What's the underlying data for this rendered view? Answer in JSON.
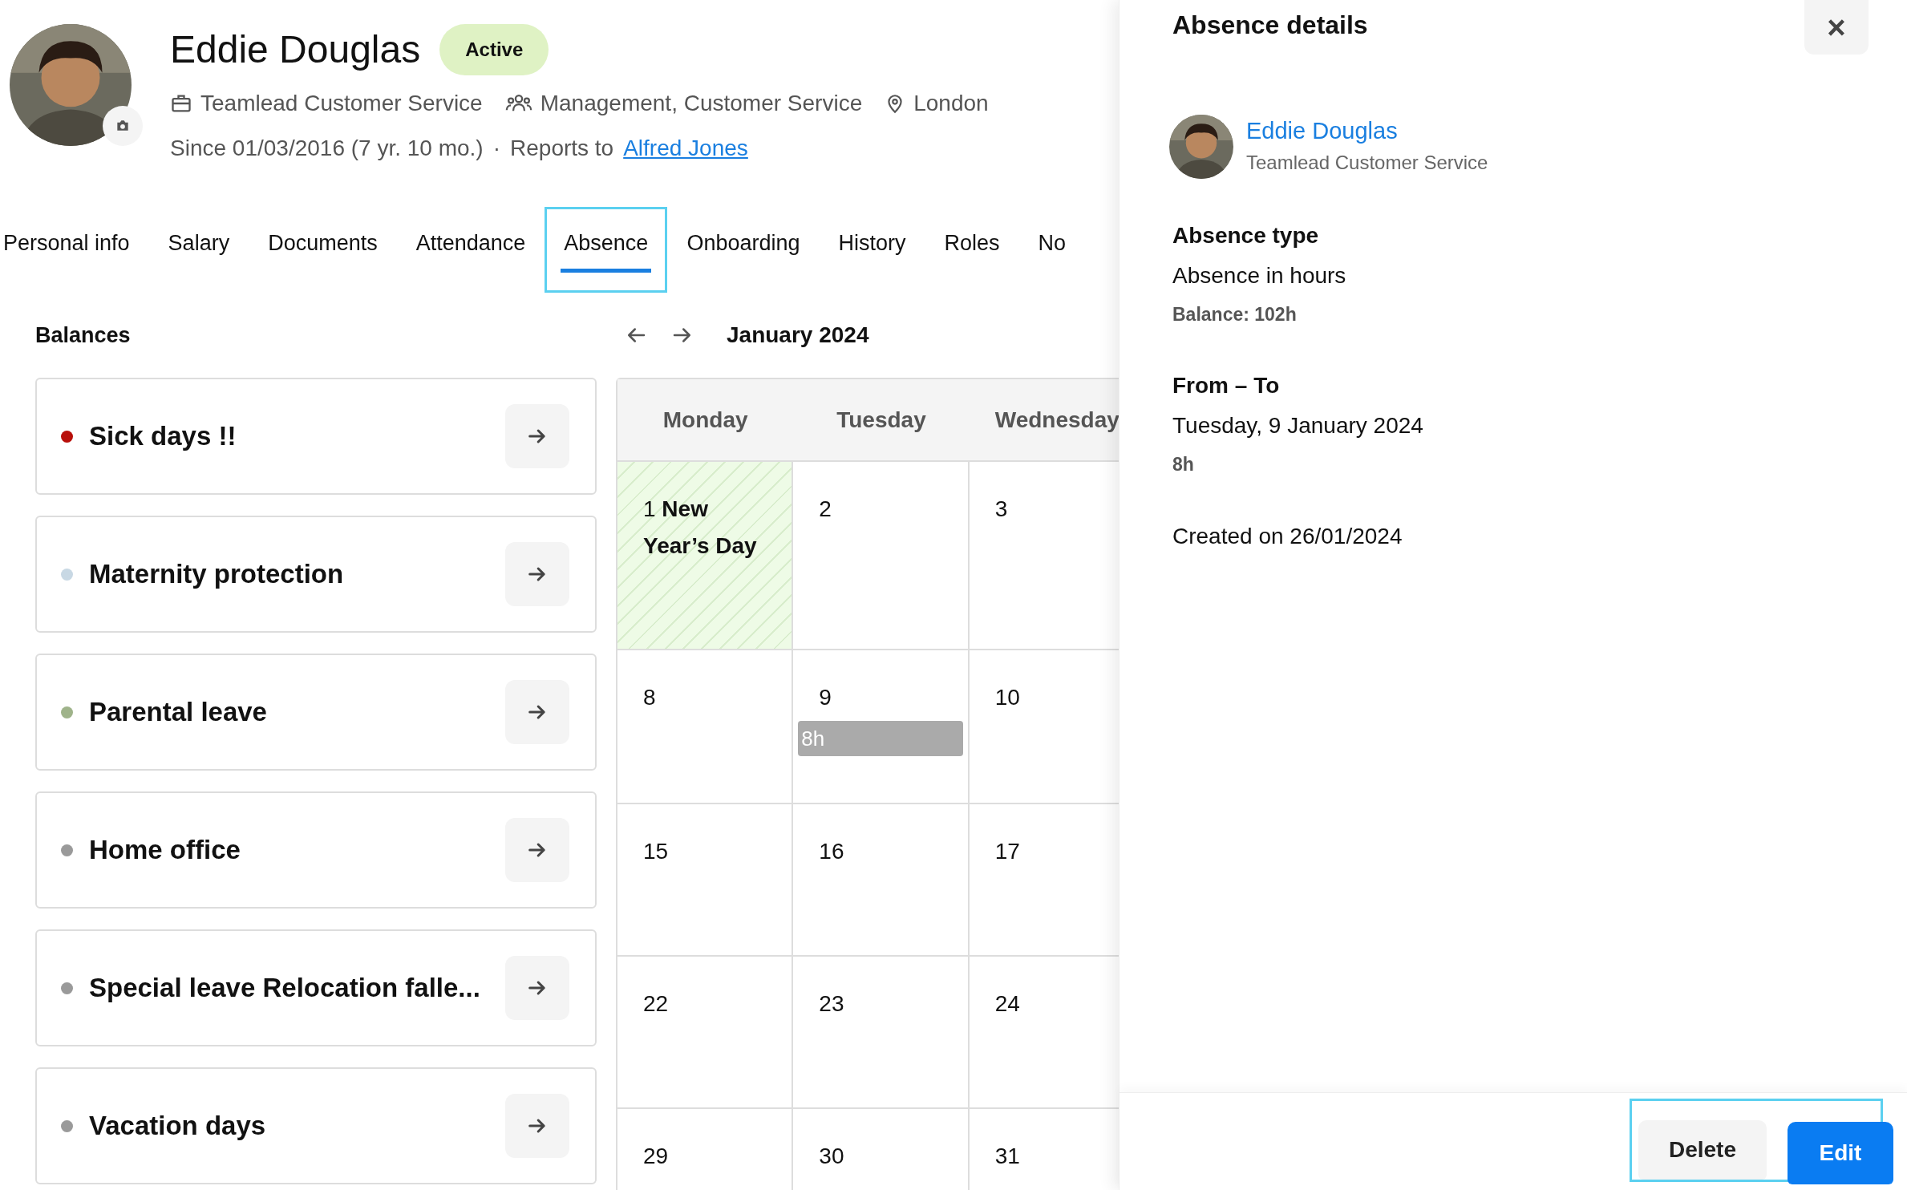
{
  "profile": {
    "name": "Eddie Douglas",
    "status": "Active",
    "position": "Teamlead Customer Service",
    "departments": "Management, Customer Service",
    "location": "London",
    "since": "Since 01/03/2016 (7 yr. 10 mo.)",
    "separator": "·",
    "reports_to_label": "Reports to",
    "manager": "Alfred Jones"
  },
  "tabs": [
    {
      "label": "Personal info",
      "selected": false,
      "highlighted": false
    },
    {
      "label": "Salary",
      "selected": false,
      "highlighted": false
    },
    {
      "label": "Documents",
      "selected": false,
      "highlighted": false
    },
    {
      "label": "Attendance",
      "selected": false,
      "highlighted": false
    },
    {
      "label": "Absence",
      "selected": true,
      "highlighted": true
    },
    {
      "label": "Onboarding",
      "selected": false,
      "highlighted": false
    },
    {
      "label": "History",
      "selected": false,
      "highlighted": false
    },
    {
      "label": "Roles",
      "selected": false,
      "highlighted": false
    },
    {
      "label": "No",
      "selected": false,
      "highlighted": false
    }
  ],
  "balances": {
    "title": "Balances",
    "items": [
      {
        "label": "Sick days !!",
        "color": "#b80f0a"
      },
      {
        "label": "Maternity protection",
        "color": "#c8d8e4"
      },
      {
        "label": "Parental leave",
        "color": "#9fb38a"
      },
      {
        "label": "Home office",
        "color": "#9a9a9a"
      },
      {
        "label": "Special leave Relocation falle...",
        "color": "#9a9a9a"
      },
      {
        "label": "Vacation days",
        "color": "#9a9a9a"
      }
    ]
  },
  "calendar": {
    "month": "January 2024",
    "weekdays": [
      "Monday",
      "Tuesday",
      "Wednesday"
    ],
    "weeks": [
      [
        {
          "day": "1",
          "holiday": "New Year’s Day"
        },
        {
          "day": "2"
        },
        {
          "day": "3"
        }
      ],
      [
        {
          "day": "8"
        },
        {
          "day": "9",
          "events": [
            "8h"
          ]
        },
        {
          "day": "10"
        }
      ],
      [
        {
          "day": "15"
        },
        {
          "day": "16"
        },
        {
          "day": "17"
        }
      ],
      [
        {
          "day": "22"
        },
        {
          "day": "23"
        },
        {
          "day": "24"
        }
      ],
      [
        {
          "day": "29"
        },
        {
          "day": "30"
        },
        {
          "day": "31"
        }
      ]
    ]
  },
  "panel": {
    "title": "Absence details",
    "close": "×",
    "employee": {
      "name": "Eddie Douglas",
      "position": "Teamlead Customer Service"
    },
    "sections": [
      {
        "heading": "Absence type",
        "value": "Absence in hours",
        "note": "Balance: 102h"
      },
      {
        "heading": "From – To",
        "value": "Tuesday, 9 January 2024",
        "note": "8h"
      }
    ],
    "created": "Created on 26/01/2024",
    "actions": {
      "highlighted": true,
      "buttons": [
        {
          "label": "Delete",
          "kind": "secondary"
        },
        {
          "label": "Edit",
          "kind": "primary"
        }
      ]
    }
  }
}
